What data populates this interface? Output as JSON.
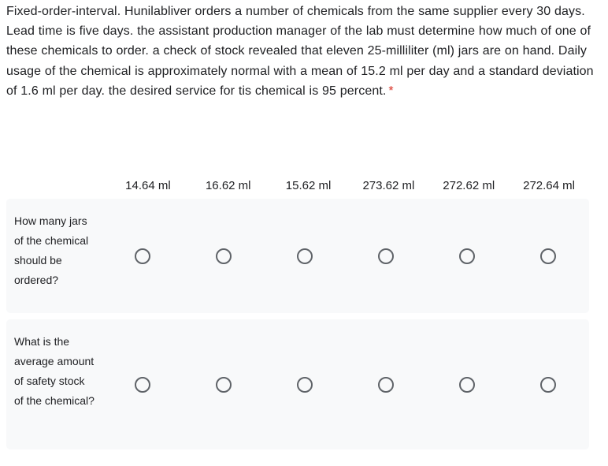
{
  "question": {
    "text": "Fixed-order-interval. Hunilabliver orders a number of chemicals from the same supplier every 30 days. Lead time is five days. the assistant production manager of the lab must determine how much of one of these chemicals to order. a check of stock revealed that eleven 25-milliliter (ml) jars are on hand. Daily usage of the chemical is approximately normal with a mean of 15.2 ml per day and a standard deviation of 1.6 ml per day. the desired service for tis chemical is 95 percent.",
    "required_marker": "*",
    "required_marker_color": "#d93025"
  },
  "grid": {
    "columns": [
      "14.64 ml",
      "16.62 ml",
      "15.62 ml",
      "273.62 ml",
      "272.62 ml",
      "272.64 ml"
    ],
    "rows": [
      {
        "label": "How many jars of the chemical should be ordered?",
        "selected": null
      },
      {
        "label": "What is the average amount of safety stock of the chemical?",
        "selected": null
      }
    ],
    "row_background": "#f8f9fa",
    "radio_border_color": "#5f6368"
  }
}
